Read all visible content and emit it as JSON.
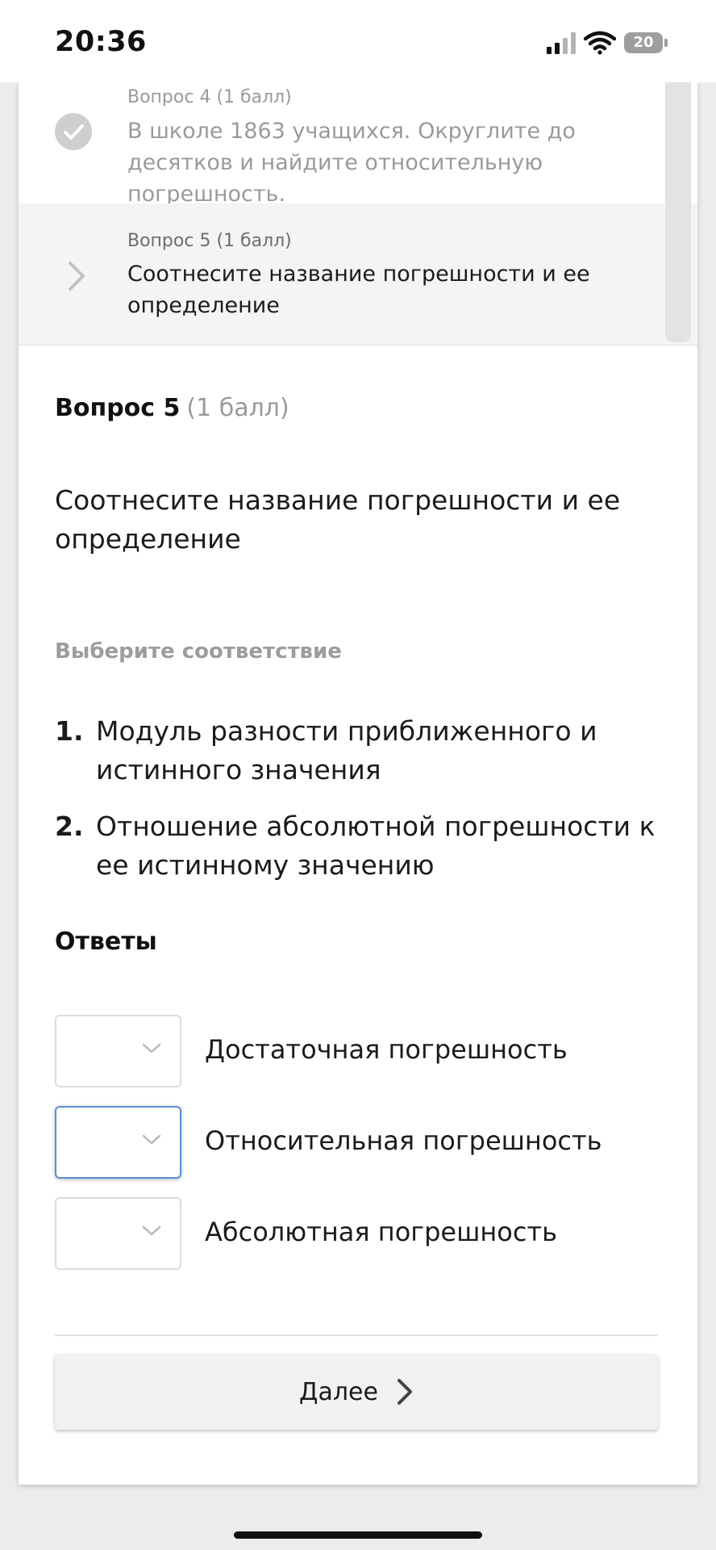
{
  "status_bar": {
    "time": "20:36",
    "battery": "20",
    "icons": [
      "cellular-signal-icon",
      "wifi-icon",
      "battery-icon"
    ]
  },
  "question_list": {
    "items": [
      {
        "meta": "Вопрос 4 (1 балл)",
        "text": "В школе 1863 учащихся. Округлите до десятков и найдите относительную погрешность.",
        "state": "answered",
        "icon": "check-icon"
      },
      {
        "meta": "Вопрос 5 (1 балл)",
        "text": "Соотнесите название погрешности и ее определение",
        "state": "current",
        "icon": "chevron-right-icon"
      }
    ]
  },
  "question": {
    "title": "Вопрос 5",
    "points": "(1 балл)",
    "text": "Соотнесите название погрешности и ее определение",
    "instruction": "Выберите соответствие",
    "definitions": [
      {
        "num": "1.",
        "text": "Модуль разности приближенного и истинного значения"
      },
      {
        "num": "2.",
        "text": "Отношение абсолютной погрешности к ее истинному значению"
      }
    ]
  },
  "answers": {
    "heading": "Ответы",
    "rows": [
      {
        "label": "Достаточная погрешность",
        "selected": ""
      },
      {
        "label": "Относительная погрешность",
        "selected": ""
      },
      {
        "label": "Абсолютная погрешность",
        "selected": ""
      }
    ]
  },
  "next_button": {
    "label": "Далее"
  },
  "colors": {
    "focus_border": "#5b8fd6",
    "muted_text": "#9a9a9a",
    "current_item_bg": "#f4f4f4"
  }
}
